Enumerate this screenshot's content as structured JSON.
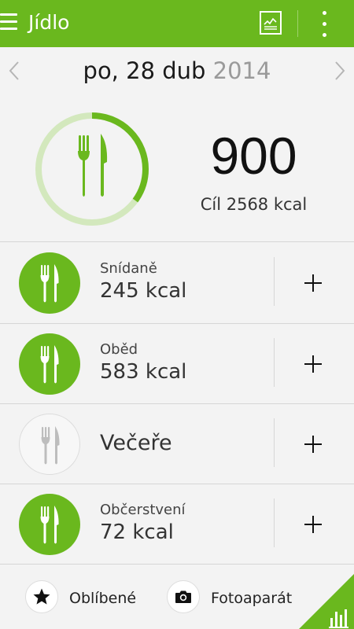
{
  "topbar": {
    "menu_icon": "hamburger-menu-icon",
    "title": "Jídlo",
    "chart_icon": "line-chart-icon",
    "more_icon": "overflow-menu-icon",
    "color": "#6ab81e"
  },
  "date_nav": {
    "prev_icon": "chevron-left-icon",
    "date": "po, 28 dub",
    "year": "2014",
    "next_icon": "chevron-right-icon"
  },
  "summary": {
    "icon": "fork-knife-icon",
    "calories": "900",
    "goal": "Cíl 2568 kcal",
    "progress_fraction": 0.35
  },
  "meals": [
    {
      "name": "Snídaně",
      "kcal": "245 kcal",
      "active": true,
      "add_label": "+"
    },
    {
      "name": "Oběd",
      "kcal": "583 kcal",
      "active": true,
      "add_label": "+"
    },
    {
      "name": "Večeře",
      "kcal": "",
      "active": false,
      "add_label": "+"
    },
    {
      "name": "Občerstvení",
      "kcal": "72 kcal",
      "active": true,
      "add_label": "+"
    }
  ],
  "bottom": {
    "favorites_icon": "star-icon",
    "favorites_label": "Oblíbené",
    "camera_icon": "camera-icon",
    "camera_label": "Fotoaparát",
    "corner_icon": "bar-chart-icon"
  },
  "colors": {
    "accent": "#6ab81e",
    "ring_track": "#d3e8bd",
    "icon_inactive": "#bdbdbd"
  }
}
